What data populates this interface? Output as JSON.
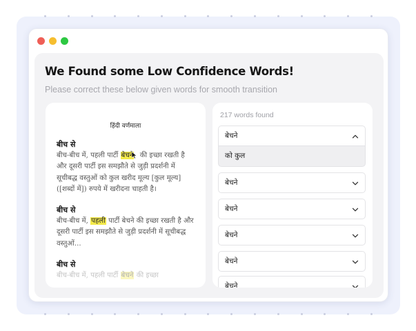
{
  "header": {
    "title": "We Found some Low Confidence Words!",
    "subtitle": "Please correct these below given words for smooth transition"
  },
  "document": {
    "heading": "हिंदी वर्णमाला",
    "paragraphs": [
      {
        "title": "बीच से",
        "before": "बीच-बीच में, पहली पार्टी ",
        "highlight": "बेचने",
        "after": " की इच्छा रखती है और दूसरी पार्टी इस समझौते से जुड़ी प्रदर्शनी में सूचीबद्ध वस्तुओं को कुल खरीद मूल्य [कुल मूल्य] ([शब्दों में]) रुपये में खरीदना चाहती है।"
      },
      {
        "title": "बीच से",
        "before": "बीच-बीच में, ",
        "highlight": "पहली",
        "after": " पार्टी बेचने की इच्छा रखती है और दूसरी पार्टी इस समझौते से जुड़ी प्रदर्शनी में सूचीबद्ध वस्तुओं..."
      },
      {
        "title": "बीच से",
        "before": "बीच-बीच में, पहली पार्टी ",
        "highlight": "बेचने",
        "after": " की इच्छा"
      }
    ]
  },
  "words": {
    "count_label": "217 words found",
    "dropdowns": [
      {
        "value": "बेचने",
        "expanded": true,
        "option": "को कुल"
      },
      {
        "value": "बेचने",
        "expanded": false
      },
      {
        "value": "बेचने",
        "expanded": false
      },
      {
        "value": "बेचने",
        "expanded": false
      },
      {
        "value": "बेचने",
        "expanded": false
      },
      {
        "value": "बेचने",
        "expanded": false
      }
    ]
  },
  "colors": {
    "highlight": "#f4ea4a",
    "close": "#ef5f57",
    "minimize": "#f6be2f",
    "maximize": "#2dc842"
  }
}
